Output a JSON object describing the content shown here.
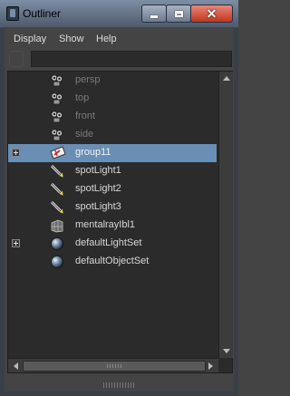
{
  "window": {
    "title": "Outliner"
  },
  "menu": [
    "Display",
    "Show",
    "Help"
  ],
  "colors": {
    "selection": "#6a8eb4",
    "dim_text": "#7a7a7a",
    "text": "#d8d8d8"
  },
  "rows": [
    {
      "label": "persp",
      "icon": "camera-icon",
      "dim": true,
      "expandable": false,
      "selected": false
    },
    {
      "label": "top",
      "icon": "camera-icon",
      "dim": true,
      "expandable": false,
      "selected": false
    },
    {
      "label": "front",
      "icon": "camera-icon",
      "dim": true,
      "expandable": false,
      "selected": false
    },
    {
      "label": "side",
      "icon": "camera-icon",
      "dim": true,
      "expandable": false,
      "selected": false
    },
    {
      "label": "group11",
      "icon": "group-transform-icon",
      "dim": false,
      "expandable": true,
      "selected": true
    },
    {
      "label": "spotLight1",
      "icon": "spotlight-icon",
      "dim": false,
      "expandable": false,
      "selected": false
    },
    {
      "label": "spotLight2",
      "icon": "spotlight-icon",
      "dim": false,
      "expandable": false,
      "selected": false
    },
    {
      "label": "spotLight3",
      "icon": "spotlight-icon",
      "dim": false,
      "expandable": false,
      "selected": false
    },
    {
      "label": "mentalrayIbl1",
      "icon": "ibl-icon",
      "dim": false,
      "expandable": false,
      "selected": false
    },
    {
      "label": "defaultLightSet",
      "icon": "set-sphere-icon",
      "dim": false,
      "expandable": true,
      "selected": false
    },
    {
      "label": "defaultObjectSet",
      "icon": "set-sphere-icon",
      "dim": false,
      "expandable": false,
      "selected": false
    }
  ]
}
